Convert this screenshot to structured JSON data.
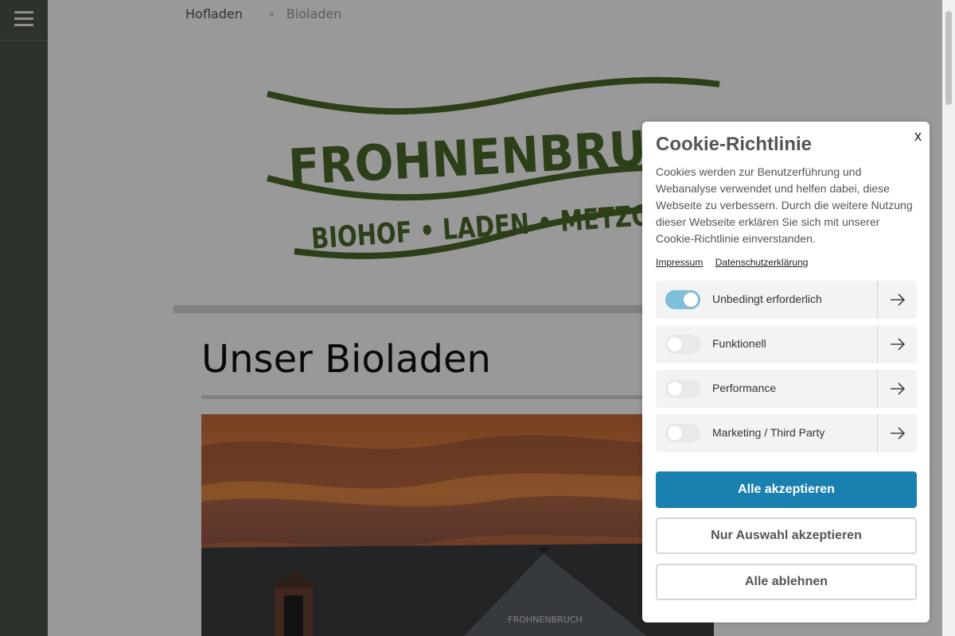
{
  "nav": {
    "menu_icon": "hamburger-menu-icon"
  },
  "breadcrumb": {
    "items": [
      "Hofladen",
      "Bioladen"
    ],
    "separator": "»"
  },
  "logo": {
    "brand": "FROHNENBRUCH",
    "tagline": "BIOHOF • LADEN • METZGEREI",
    "color": "#4a6a2a"
  },
  "main": {
    "heading": "Unser Bioladen",
    "photo_sign": "FROHNENBRUCH"
  },
  "cookie": {
    "title": "Cookie-Richtlinie",
    "close_label": "x",
    "description": "Cookies werden zur Benutzerführung und Webanalyse verwendet und helfen dabei, diese Webseite zu verbessern. Durch die weitere Nutzung dieser Webseite erklären Sie sich mit unserer Cookie-Richtlinie einverstanden.",
    "links": [
      "Impressum",
      "Datenschutzerklärung"
    ],
    "categories": [
      {
        "label": "Unbedingt erforderlich",
        "enabled": true
      },
      {
        "label": "Funktionell",
        "enabled": false
      },
      {
        "label": "Performance",
        "enabled": false
      },
      {
        "label": "Marketing / Third Party",
        "enabled": false
      }
    ],
    "buttons": {
      "accept_all": "Alle akzeptieren",
      "accept_selection": "Nur Auswahl akzeptieren",
      "reject_all": "Alle ablehnen"
    },
    "accent_color": "#1a80b0"
  }
}
